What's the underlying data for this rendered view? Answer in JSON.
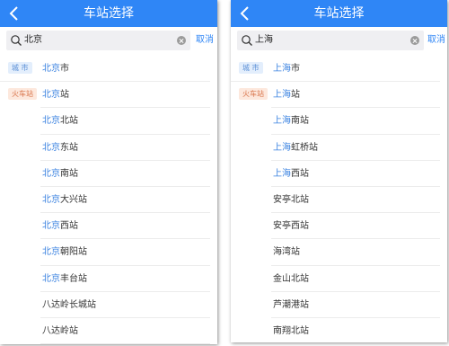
{
  "screens": [
    {
      "title": "车站选择",
      "search_value": "北京",
      "cancel_label": "取消",
      "rows": [
        {
          "badge": "城 市",
          "badge_type": "city",
          "hl": "北京",
          "rest": "市"
        },
        {
          "badge": "火车站",
          "badge_type": "train",
          "hl": "北京",
          "rest": "站"
        },
        {
          "badge": "",
          "hl": "北京",
          "rest": "北站"
        },
        {
          "badge": "",
          "hl": "北京",
          "rest": "东站"
        },
        {
          "badge": "",
          "hl": "北京",
          "rest": "南站"
        },
        {
          "badge": "",
          "hl": "北京",
          "rest": "大兴站"
        },
        {
          "badge": "",
          "hl": "北京",
          "rest": "西站"
        },
        {
          "badge": "",
          "hl": "北京",
          "rest": "朝阳站"
        },
        {
          "badge": "",
          "hl": "北京",
          "rest": "丰台站"
        },
        {
          "badge": "",
          "hl": "",
          "rest": "八达岭长城站"
        },
        {
          "badge": "",
          "hl": "",
          "rest": "八达岭站"
        }
      ]
    },
    {
      "title": "车站选择",
      "search_value": "上海",
      "cancel_label": "取消",
      "rows": [
        {
          "badge": "城 市",
          "badge_type": "city",
          "hl": "上海",
          "rest": "市"
        },
        {
          "badge": "火车站",
          "badge_type": "train",
          "hl": "上海",
          "rest": "站"
        },
        {
          "badge": "",
          "hl": "上海",
          "rest": "南站"
        },
        {
          "badge": "",
          "hl": "上海",
          "rest": "虹桥站"
        },
        {
          "badge": "",
          "hl": "上海",
          "rest": "西站"
        },
        {
          "badge": "",
          "hl": "",
          "rest": "安亭北站"
        },
        {
          "badge": "",
          "hl": "",
          "rest": "安亭西站"
        },
        {
          "badge": "",
          "hl": "",
          "rest": "海湾站"
        },
        {
          "badge": "",
          "hl": "",
          "rest": "金山北站"
        },
        {
          "badge": "",
          "hl": "",
          "rest": "芦潮港站"
        },
        {
          "badge": "",
          "hl": "",
          "rest": "南翔北站"
        }
      ]
    }
  ],
  "colors": {
    "header": "#2f86f6",
    "highlight": "#3a82e0",
    "city_badge": "#5b8fd6",
    "train_badge": "#d9764d"
  }
}
